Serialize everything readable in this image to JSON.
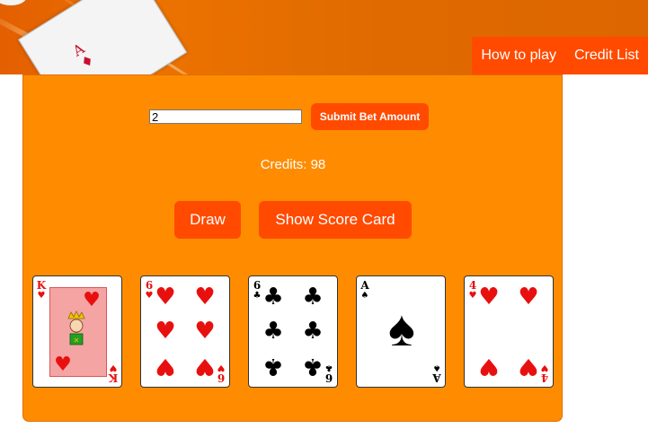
{
  "nav": {
    "items": [
      "How to play",
      "Credit List"
    ]
  },
  "bet": {
    "input_value": "2",
    "submit_label": "Submit Bet Amount"
  },
  "credits": {
    "label": "Credits:",
    "value": "98"
  },
  "actions": {
    "draw_label": "Draw",
    "score_card_label": "Show Score Card"
  },
  "hand": [
    {
      "rank": "K",
      "suit": "hearts",
      "suit_symbol": "♥",
      "color": "red"
    },
    {
      "rank": "6",
      "suit": "hearts",
      "suit_symbol": "♥",
      "color": "red"
    },
    {
      "rank": "6",
      "suit": "clubs",
      "suit_symbol": "♣",
      "color": "black"
    },
    {
      "rank": "A",
      "suit": "spades",
      "suit_symbol": "♠",
      "color": "black"
    },
    {
      "rank": "4",
      "suit": "hearts",
      "suit_symbol": "♥",
      "color": "red"
    }
  ],
  "header_logo": {
    "card_rank": "A",
    "card_suit_symbol": "♦"
  },
  "colors": {
    "header": "#e46800",
    "nav": "#ff4a00",
    "panel": "#ff8c00",
    "button": "#ff4a00",
    "red_suit": "#e8100f"
  }
}
